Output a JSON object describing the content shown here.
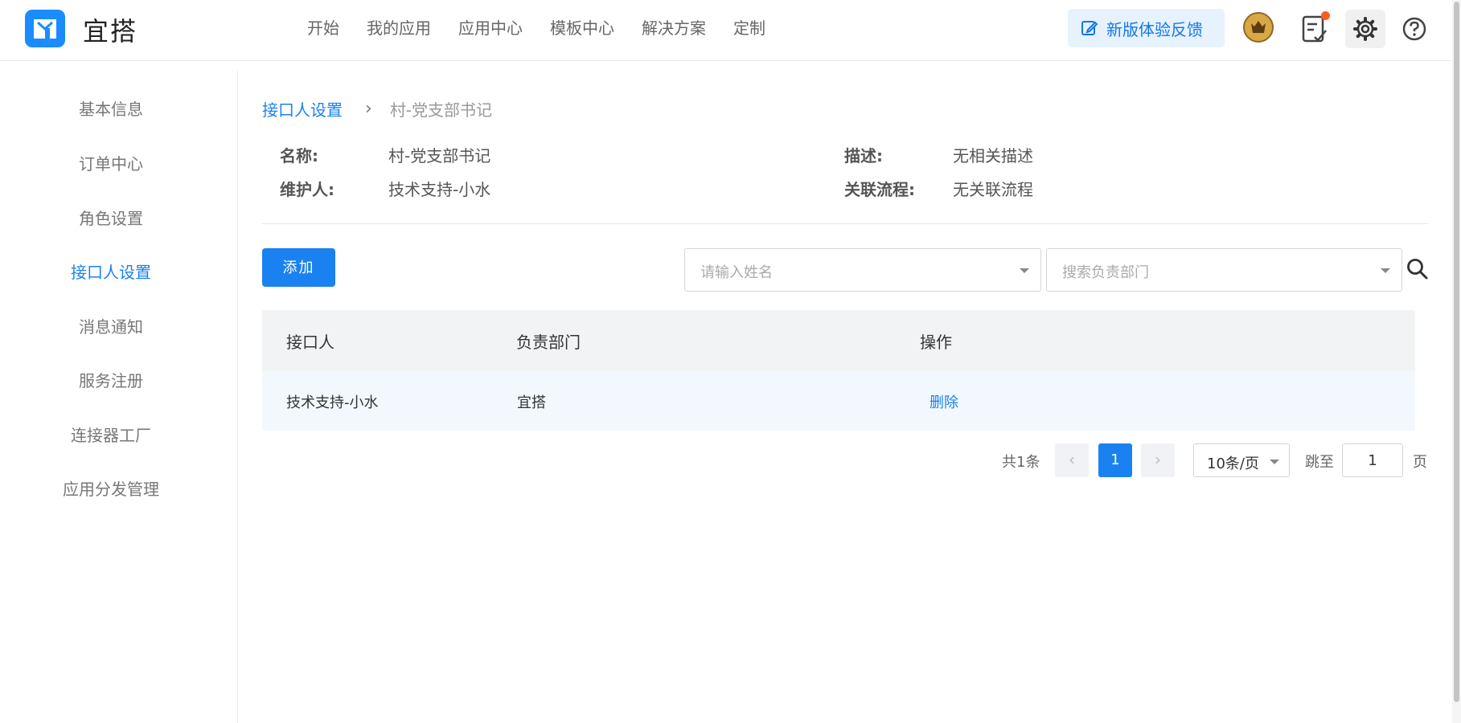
{
  "header": {
    "brand": "宜搭",
    "nav": [
      "开始",
      "我的应用",
      "应用中心",
      "模板中心",
      "解决方案",
      "定制"
    ],
    "feedback_label": "新版体验反馈"
  },
  "sidebar": {
    "items": [
      "基本信息",
      "订单中心",
      "角色设置",
      "接口人设置",
      "消息通知",
      "服务注册",
      "连接器工厂",
      "应用分发管理"
    ],
    "active": "接口人设置"
  },
  "breadcrumb": {
    "parent": "接口人设置",
    "separator": "›",
    "current": "村-党支部书记"
  },
  "info": {
    "name_label": "名称:",
    "name_value": "村-党支部书记",
    "desc_label": "描述:",
    "desc_value": "无相关描述",
    "maintainer_label": "维护人:",
    "maintainer_value": "技术支持-小水",
    "flow_label": "关联流程:",
    "flow_value": "无关联流程"
  },
  "toolbar": {
    "add_label": "添加",
    "name_placeholder": "请输入姓名",
    "dept_placeholder": "搜索负责部门"
  },
  "table": {
    "columns": [
      "接口人",
      "负责部门",
      "操作"
    ],
    "rows": [
      {
        "contact": "技术支持-小水",
        "department": "宜搭",
        "action": "删除"
      }
    ]
  },
  "pagination": {
    "total": "共1条",
    "prev": "‹",
    "current_page": "1",
    "next": "›",
    "page_size": "10条/页",
    "jump_label": "跳至",
    "jump_value": "1",
    "page_suffix": "页"
  },
  "colors": {
    "accent": "#1a82f0",
    "feedback_bg": "#e6f2fd",
    "table_header_bg": "#f2f3f5",
    "table_row_bg": "#f2f8fe",
    "badge": "#ff5a1f"
  }
}
